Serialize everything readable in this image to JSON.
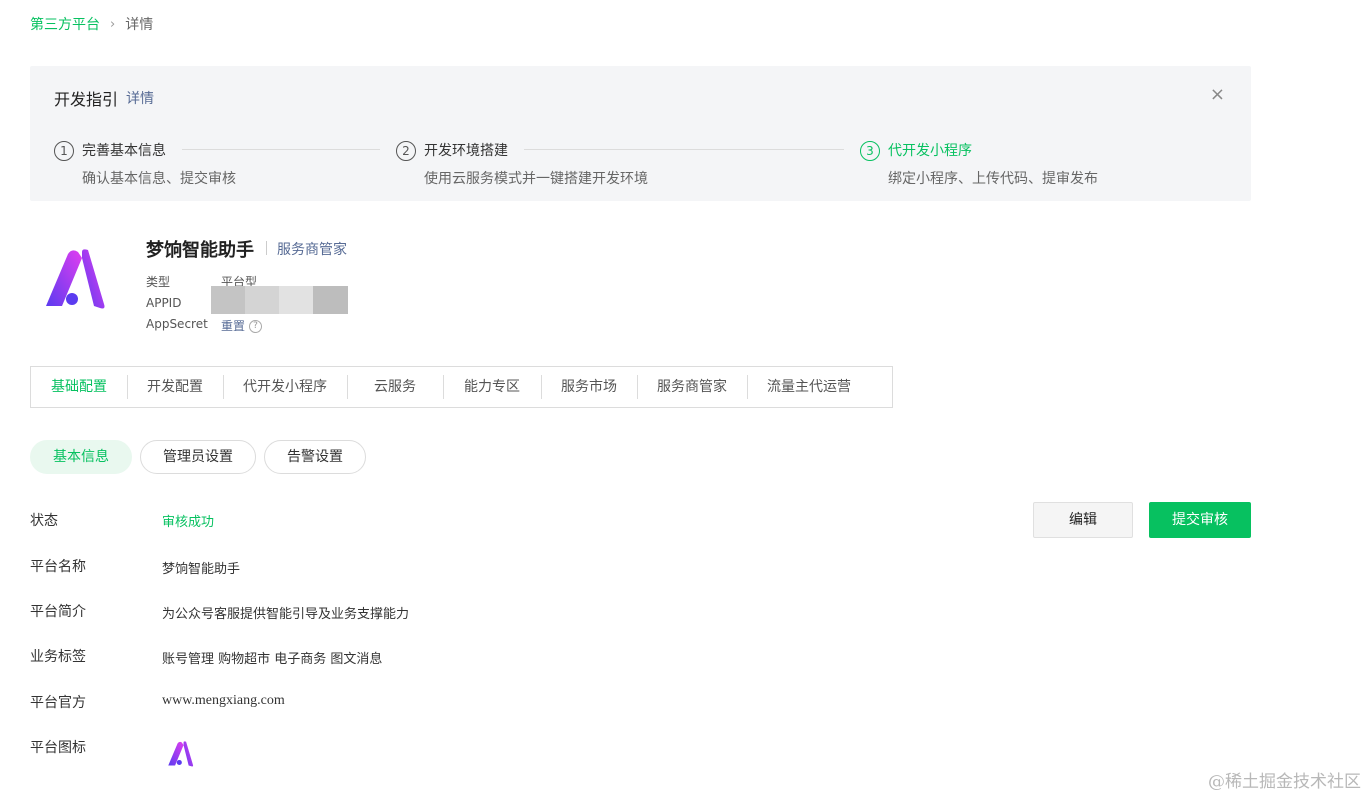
{
  "breadcrumb": {
    "parent": "第三方平台",
    "separator": "›",
    "current": "详情"
  },
  "guide": {
    "title": "开发指引",
    "detail_link": "详情",
    "close_icon": "×",
    "steps": [
      {
        "num": "1",
        "title": "完善基本信息",
        "desc": "确认基本信息、提交审核"
      },
      {
        "num": "2",
        "title": "开发环境搭建",
        "desc": "使用云服务模式并一键搭建开发环境"
      },
      {
        "num": "3",
        "title": "代开发小程序",
        "desc": "绑定小程序、上传代码、提审发布"
      }
    ],
    "active_step": 3
  },
  "app": {
    "name": "梦饷智能助手",
    "role": "服务商管家",
    "type_label": "类型",
    "type_value": "平台型",
    "appid_label": "APPID",
    "appsecret_label": "AppSecret",
    "appsecret_action": "重置",
    "help_icon": "?"
  },
  "tabs": [
    {
      "label": "基础配置",
      "active": true
    },
    {
      "label": "开发配置"
    },
    {
      "label": "代开发小程序"
    },
    {
      "label": "云服务"
    },
    {
      "label": "能力专区"
    },
    {
      "label": "服务市场"
    },
    {
      "label": "服务商管家"
    },
    {
      "label": "流量主代运营"
    }
  ],
  "subtabs": [
    {
      "label": "基本信息",
      "active": true
    },
    {
      "label": "管理员设置"
    },
    {
      "label": "告警设置"
    }
  ],
  "info": {
    "status_label": "状态",
    "status_value": "审核成功",
    "name_label": "平台名称",
    "name_value": "梦饷智能助手",
    "intro_label": "平台简介",
    "intro_value": "为公众号客服提供智能引导及业务支撑能力",
    "tags_label": "业务标签",
    "tags_value": "账号管理 购物超市 电子商务 图文消息",
    "site_label": "平台官方",
    "site_value": "www.mengxiang.com",
    "icon_label": "平台图标"
  },
  "actions": {
    "edit": "编辑",
    "submit": "提交审核"
  },
  "watermark": "@稀土掘金技术社区",
  "colors": {
    "accent": "#07c160",
    "link": "#576b95",
    "logo_gradient": [
      "#5b3bf0",
      "#e13ef0"
    ]
  }
}
